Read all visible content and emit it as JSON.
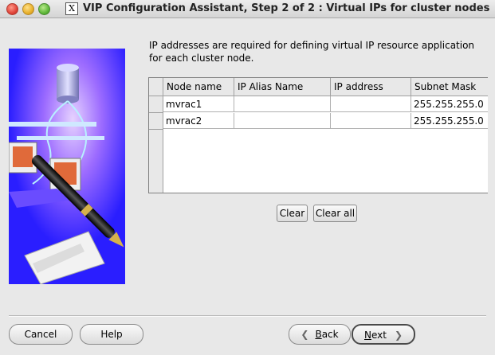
{
  "window": {
    "title": "VIP Configuration Assistant, Step 2 of 2 : Virtual IPs for cluster nodes",
    "app_icon": "X"
  },
  "intro_text": "IP addresses are required for defining virtual IP resource application for each cluster node.",
  "table": {
    "columns": [
      "Node name",
      "IP Alias Name",
      "IP address",
      "Subnet Mask"
    ],
    "rows": [
      [
        "mvrac1",
        "",
        "",
        "255.255.255.0"
      ],
      [
        "mvrac2",
        "",
        "",
        "255.255.255.0"
      ]
    ]
  },
  "buttons": {
    "clear": "Clear",
    "clear_all": "Clear all",
    "cancel": "Cancel",
    "help": "Help",
    "back_mnemonic": "B",
    "back_rest": "ack",
    "next_mnemonic": "N",
    "next_rest": "ext"
  },
  "colors": {
    "illustration_bg": "#2a1eff",
    "window_bg": "#e8e8e8"
  },
  "icons": {
    "back": "chevron-left-icon",
    "next": "chevron-right-icon"
  }
}
